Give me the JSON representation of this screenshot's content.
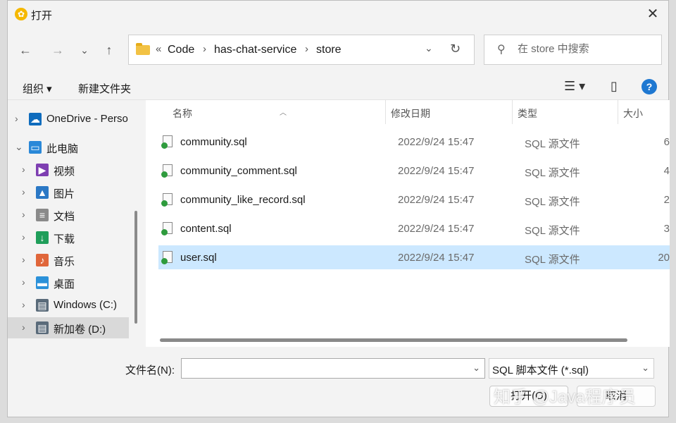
{
  "window": {
    "title": "打开",
    "close_glyph": "✕"
  },
  "navigation": {
    "back": "←",
    "forward": "→",
    "recent": "⌄",
    "up": "↑"
  },
  "address": {
    "breadcrumbs": [
      "«",
      "Code",
      "has-chat-service",
      "store"
    ],
    "separator": "›",
    "dropdown": "⌄",
    "refresh": "↻"
  },
  "search": {
    "placeholder": "在 store 中搜索",
    "icon": "search-icon"
  },
  "toolbar": {
    "organize": "组织 ▾",
    "new_folder": "新建文件夹",
    "view": "☰ ▾",
    "preview": "▯",
    "help": "?"
  },
  "nav_tree": [
    {
      "label": "OneDrive - Perso",
      "icon": "onedrive-icon",
      "glyph": "☁",
      "color": "#0f6cbd",
      "indent": 0
    },
    {
      "label": "此电脑",
      "icon": "computer-icon",
      "glyph": "▭",
      "color": "#2a88d8",
      "indent": 0,
      "expanded": true
    },
    {
      "label": "视频",
      "icon": "video-icon",
      "glyph": "▶",
      "color": "#7e3fb1",
      "indent": 1
    },
    {
      "label": "图片",
      "icon": "picture-icon",
      "glyph": "▲",
      "color": "#2b78c5",
      "indent": 1
    },
    {
      "label": "文档",
      "icon": "document-icon",
      "glyph": "≡",
      "color": "#8a8a8a",
      "indent": 1
    },
    {
      "label": "下载",
      "icon": "download-icon",
      "glyph": "↓",
      "color": "#1f9e5a",
      "indent": 1
    },
    {
      "label": "音乐",
      "icon": "music-icon",
      "glyph": "♪",
      "color": "#e0663a",
      "indent": 1
    },
    {
      "label": "桌面",
      "icon": "desktop-icon",
      "glyph": "▬",
      "color": "#2b91d9",
      "indent": 1
    },
    {
      "label": "Windows (C:)",
      "icon": "drive-icon",
      "glyph": "▤",
      "color": "#5a6b7a",
      "indent": 1
    },
    {
      "label": "新加卷 (D:)",
      "icon": "drive-icon",
      "glyph": "▤",
      "color": "#5a6b7a",
      "indent": 1,
      "selected": true
    }
  ],
  "columns": {
    "name": "名称",
    "date": "修改日期",
    "type": "类型",
    "size": "大小"
  },
  "files": [
    {
      "name": "community.sql",
      "date": "2022/9/24 15:47",
      "type": "SQL 源文件",
      "size": "6"
    },
    {
      "name": "community_comment.sql",
      "date": "2022/9/24 15:47",
      "type": "SQL 源文件",
      "size": "4"
    },
    {
      "name": "community_like_record.sql",
      "date": "2022/9/24 15:47",
      "type": "SQL 源文件",
      "size": "2"
    },
    {
      "name": "content.sql",
      "date": "2022/9/24 15:47",
      "type": "SQL 源文件",
      "size": "3"
    },
    {
      "name": "user.sql",
      "date": "2022/9/24 15:47",
      "type": "SQL 源文件",
      "size": "20",
      "selected": true
    }
  ],
  "footer": {
    "filename_label": "文件名(N):",
    "filename_value": "",
    "filetype": "SQL 脚本文件 (*.sql)",
    "open_label": "打开(O)",
    "cancel_label": "取消"
  },
  "watermark": "知乎 @Java程序员"
}
